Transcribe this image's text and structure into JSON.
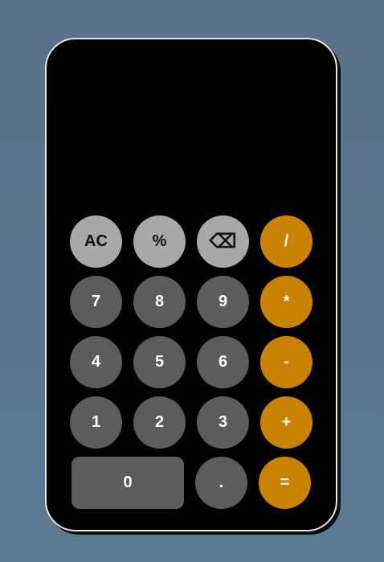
{
  "display": {
    "value": ""
  },
  "buttons": {
    "ac": "AC",
    "percent": "%",
    "backspace": "⌫",
    "divide": "/",
    "seven": "7",
    "eight": "8",
    "nine": "9",
    "multiply": "*",
    "four": "4",
    "five": "5",
    "six": "6",
    "subtract": "-",
    "one": "1",
    "two": "2",
    "three": "3",
    "add": "+",
    "zero": "0",
    "decimal": ".",
    "equals": "="
  },
  "colors": {
    "background": "#5b7089",
    "calculator": "#000000",
    "function_key": "#a8a8a8",
    "number_key": "#5c5c5c",
    "operator_key": "#c98200"
  },
  "icons": {
    "backspace": "backspace-icon"
  }
}
